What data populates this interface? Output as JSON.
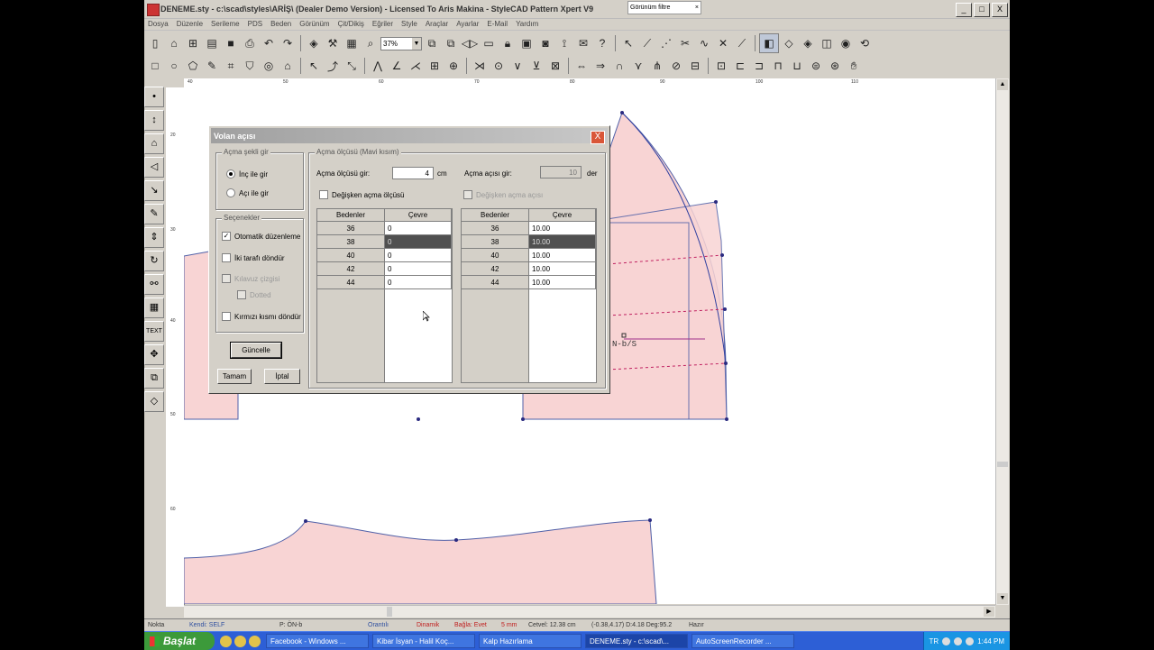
{
  "window": {
    "title": "DENEME.sty - c:\\scad\\styles\\ARİŞ\\ (Dealer Demo Version) - Licensed To Aris Makina - StyleCAD Pattern Xpert V9",
    "search_placeholder": "Görünüm filtre",
    "buttons": [
      "_",
      "□",
      "X"
    ]
  },
  "menu": [
    "Dosya",
    "Düzenle",
    "Serileme",
    "PDS",
    "Beden",
    "Görünüm",
    "Çit/Dikiş",
    "Eğriler",
    "Style",
    "Araçlar",
    "Ayarlar",
    "E-Mail",
    "Yardım"
  ],
  "toolbar": {
    "zoom": "37%",
    "row1_icons": [
      "new-icon",
      "open-icon",
      "open-multi-icon",
      "save-all-icon",
      "save-icon",
      "print-icon",
      "undo-icon",
      "redo-icon",
      "measure-icon",
      "hammer-icon",
      "grid-icon",
      "zoom-icon",
      "zoom-dropdown",
      "copy-left-icon",
      "copy-right-icon",
      "mirror-icon",
      "page-icon",
      "lock-icon",
      "image-icon",
      "camera-icon",
      "connect-icon",
      "mail-icon",
      "help-icon",
      "select-icon",
      "line-angle-icon",
      "line-dash-icon",
      "line-cut-icon",
      "line-curve-icon",
      "line-cross-icon",
      "line-end-icon",
      "layer-icon",
      "piece-icon",
      "piece-rotate-icon",
      "piece-split-icon",
      "piece-cut-icon",
      "piece-flip-icon"
    ],
    "row2_icons": [
      "rect-icon",
      "circle-icon",
      "polygon-icon",
      "pen-icon",
      "trace-icon",
      "shirt-icon",
      "spiral-icon",
      "house-icon",
      "arrow-select-icon",
      "curve-edit-icon",
      "point-edit-icon",
      "fold-icon",
      "angle-icon",
      "notch-icon",
      "cross-icon",
      "split-icon",
      "stitch-icon",
      "button-icon",
      "dart-icon",
      "dart-move-icon",
      "dart-close-icon",
      "pleat-icon",
      "seam-icon",
      "fold-line-icon",
      "add-point-icon",
      "move-point-icon",
      "slash-icon",
      "spread-icon",
      "pivot-icon",
      "align-icon",
      "rotate-icon",
      "mirror-piece-icon",
      "join-icon",
      "measure-piece-icon",
      "flare-icon",
      "hand-icon"
    ]
  },
  "left_tools": [
    "point-tool-icon",
    "line-tool-icon",
    "text-tool-icon",
    "shape-tool-icon",
    "arrow-tool-icon",
    "pen-tool-icon",
    "measure-tool-icon",
    "rotate-tool-icon",
    "link-tool-icon",
    "grid-tool-icon",
    "TEXT",
    "move-tool-icon",
    "copy-tool-icon",
    "piece-tool-icon"
  ],
  "ruler": {
    "top_ticks": [
      "40",
      "50",
      "60",
      "70",
      "80",
      "90",
      "100",
      "110"
    ],
    "left_ticks": [
      "20",
      "30",
      "40",
      "50",
      "60",
      "70",
      "80"
    ]
  },
  "canvas": {
    "label": "N-b/S",
    "colors": {
      "fill": "#f8d4d4",
      "outline": "#5060a8",
      "point": "#2a2a80",
      "mark": "#c02060"
    }
  },
  "dialog": {
    "title": "Volan açısı",
    "close": "X",
    "group_method": "Açma şekli gir",
    "radio_inch": "İnç ile gir",
    "radio_angle": "Açı ile gir",
    "group_options": "Seçenekler",
    "opt_auto": "Otomatik düzenleme",
    "opt_rotate_both": "İki tarafı döndür",
    "opt_guide": "Kılavuz çizgisi",
    "opt_dotted": "Dotted",
    "opt_red": "Kırmızı kısmı döndür",
    "btn_update": "Güncelle",
    "btn_ok": "Tamam",
    "btn_cancel": "İptal",
    "group_measure": "Açma ölçüsü (Mavi kısım)",
    "measure_label": "Açma ölçüsü gir:",
    "measure_value": "4",
    "measure_unit": "cm",
    "angle_label": "Açma açısı gir:",
    "angle_value": "10",
    "angle_unit": "der",
    "chk_var_measure": "Değişken açma ölçüsü",
    "chk_var_angle": "Değişken açma açısı",
    "col_size": "Bedenler",
    "col_circ": "Çevre",
    "sizes": [
      "36",
      "38",
      "40",
      "42",
      "44"
    ],
    "left_values": [
      "0",
      "0",
      "0",
      "0",
      "0"
    ],
    "right_values": [
      "10.00",
      "10.00",
      "10.00",
      "10.00",
      "10.00"
    ],
    "selected_row": 1
  },
  "status": {
    "nokta": "Nokta",
    "kendi": "Kendi: SELF",
    "piece": "P: ÖN-b",
    "orantili": "Orantılı",
    "dinamik": "Dinamik",
    "bagla": "Bağla: Evet",
    "mm": "5 mm",
    "cetvel": "Cetvel: 12.38 cm",
    "coords": "(-0.38,4.17) D:4.18 Deg:95.2",
    "hazir": "Hazır"
  },
  "taskbar": {
    "start": "Başlat",
    "tasks": [
      "Facebook - Windows ...",
      "Kibar İsyan - Halil Koç...",
      "Kalp Hazırlama",
      "DENEME.sty - c:\\scad\\...",
      "AutoScreenRecorder ..."
    ],
    "active_task": 3,
    "lang": "TR",
    "clock": "1:44 PM"
  }
}
